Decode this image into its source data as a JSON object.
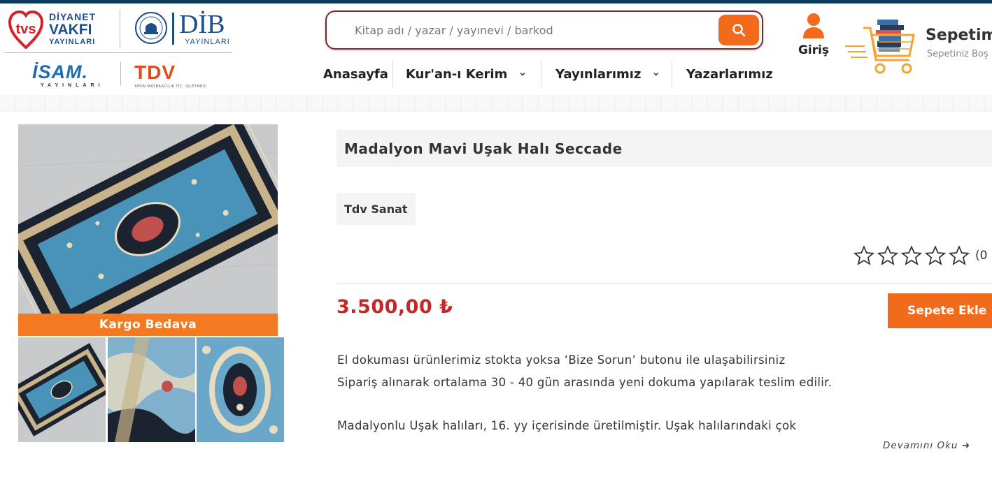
{
  "brand_logos": {
    "diyanet_vakfi": {
      "line1": "DİYANET",
      "line2": "VAKFI",
      "line3": "YAYINLARI"
    },
    "dib": {
      "big": "DİB",
      "small": "YAYINLARI"
    },
    "isam": {
      "big": "İSAM.",
      "small": "YAYINLARI"
    },
    "tdv": {
      "big": "TDV",
      "small": "YAYIN MATBAACILIK TİC. İŞLETMESİ"
    }
  },
  "search": {
    "placeholder": "Kitap adı / yazar / yayınevi / barkod",
    "value": "",
    "icon": "search-icon"
  },
  "nav": {
    "items": [
      {
        "label": "Anasayfa",
        "has_dropdown": false
      },
      {
        "label": "Kur'an-ı Kerim",
        "has_dropdown": true
      },
      {
        "label": "Yayınlarımız",
        "has_dropdown": true
      },
      {
        "label": "Yazarlarımız",
        "has_dropdown": false
      }
    ]
  },
  "login": {
    "label": "Giriş",
    "icon": "user-icon"
  },
  "cart": {
    "title": "Sepetim",
    "subtitle": "Sepetiniz Boş",
    "icon": "shopping-cart-icon"
  },
  "product": {
    "title": "Madalyon Mavi Uşak Halı Seccade",
    "brand": "Tdv Sanat",
    "rating": {
      "stars": 0,
      "max": 5,
      "count_text": "(0"
    },
    "price": "3.500,00 ₺",
    "add_to_cart": "Sepete Ekle",
    "badge": "Kargo Bedava",
    "description": [
      "El dokuması ürünlerimiz stokta yoksa ‘Bize Sorun’ butonu ile ulaşabilirsiniz",
      "Sipariş alınarak ortalama 30 - 40 gün arasında yeni dokuma yapılarak teslim edilir.",
      "Madalyonlu Uşak halıları, 16. yy içerisinde üretilmiştir. Uşak halılarındaki çok"
    ],
    "read_more": "Devamını Oku ➜"
  },
  "colors": {
    "accent_orange": "#f26a1b",
    "price_red": "#c62828",
    "topbar_navy": "#0b3b5c",
    "logo_blue": "#1e4f8a",
    "rug_blue": "#4a93b8",
    "rug_dark": "#1b2230"
  }
}
